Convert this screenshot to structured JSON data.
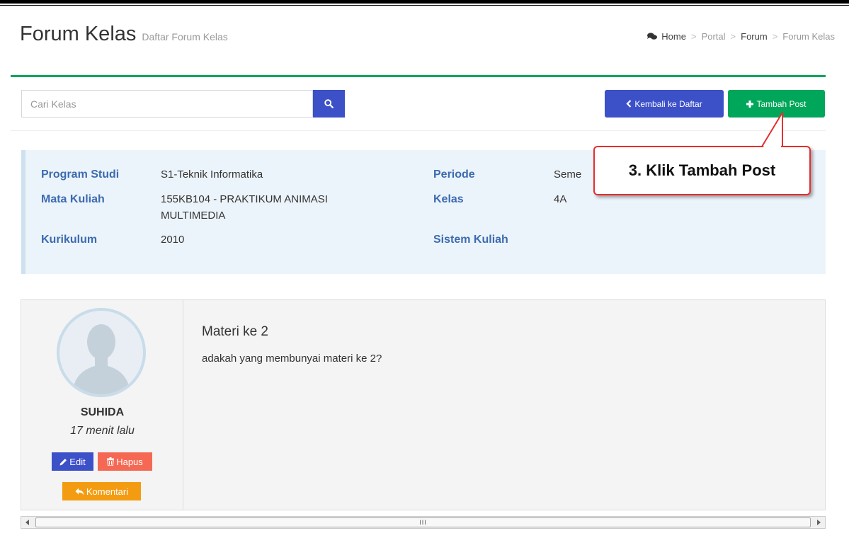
{
  "header": {
    "title": "Forum Kelas",
    "subtitle": "Daftar Forum Kelas"
  },
  "breadcrumb": {
    "icon": "comments-icon",
    "items": [
      "Home",
      "Portal",
      "Forum",
      "Forum Kelas"
    ],
    "separator": ">"
  },
  "toolbar": {
    "search_placeholder": "Cari Kelas",
    "search_value": "",
    "back_label": "Kembali ke Daftar",
    "add_label": "Tambah Post"
  },
  "class_info": {
    "program_studi_label": "Program Studi",
    "program_studi_value": "S1-Teknik Informatika",
    "mata_kuliah_label": "Mata Kuliah",
    "mata_kuliah_value_line1": "155KB104 - PRAKTIKUM ANIMASI",
    "mata_kuliah_value_line2": "MULTIMEDIA",
    "kurikulum_label": "Kurikulum",
    "kurikulum_value": "2010",
    "periode_label": "Periode",
    "periode_value": "Seme",
    "kelas_label": "Kelas",
    "kelas_value": "4A",
    "sistem_kuliah_label": "Sistem Kuliah",
    "sistem_kuliah_value": ""
  },
  "post": {
    "author": "SUHIDA",
    "time": "17 menit lalu",
    "title": "Materi ke 2",
    "body": "adakah yang membunyai materi ke 2?",
    "edit_label": "Edit",
    "delete_label": "Hapus",
    "comment_label": "Komentari"
  },
  "scrollbar": {
    "grip": "III"
  },
  "annotation": {
    "text": "3. Klik Tambah Post"
  },
  "colors": {
    "primary": "#3c50c8",
    "success": "#00a65a",
    "danger": "#f56954",
    "warning": "#f39c12",
    "label": "#3c6bb0",
    "callout_border": "#e62e2e"
  }
}
